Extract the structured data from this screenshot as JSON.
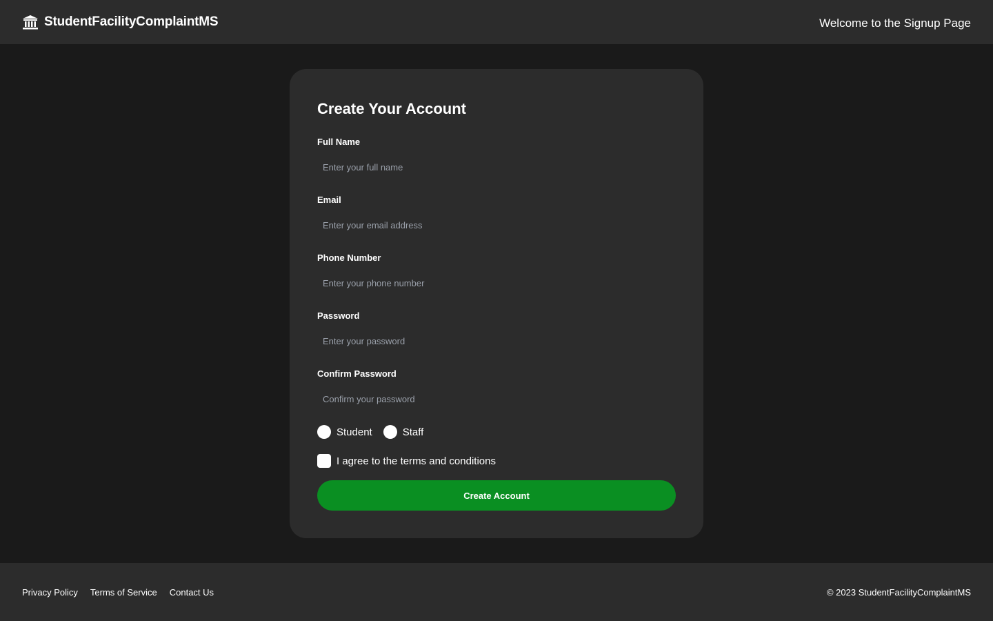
{
  "header": {
    "brand_icon": "institution-icon",
    "brand_name": "StudentFacilityComplaintMS",
    "welcome_text": "Welcome to the Signup Page"
  },
  "form": {
    "title": "Create Your Account",
    "fields": [
      {
        "label": "Full Name",
        "placeholder": "Enter your full name",
        "value": ""
      },
      {
        "label": "Email",
        "placeholder": "Enter your email address",
        "value": ""
      },
      {
        "label": "Phone Number",
        "placeholder": "Enter your phone number",
        "value": ""
      },
      {
        "label": "Password",
        "placeholder": "Enter your password",
        "value": ""
      },
      {
        "label": "Confirm Password",
        "placeholder": "Confirm your password",
        "value": ""
      }
    ],
    "roles": [
      {
        "label": "Student",
        "selected": false
      },
      {
        "label": "Staff",
        "selected": false
      }
    ],
    "terms_label": "I agree to the terms and conditions",
    "terms_checked": false,
    "submit_label": "Create Account"
  },
  "footer": {
    "links": [
      "Privacy Policy",
      "Terms of Service",
      "Contact Us"
    ],
    "copyright": "© 2023 StudentFacilityComplaintMS"
  },
  "colors": {
    "page_bg": "#1a1a1a",
    "panel_bg": "#2c2c2c",
    "accent_green": "#0a8f22",
    "placeholder": "#9aa0aa"
  }
}
